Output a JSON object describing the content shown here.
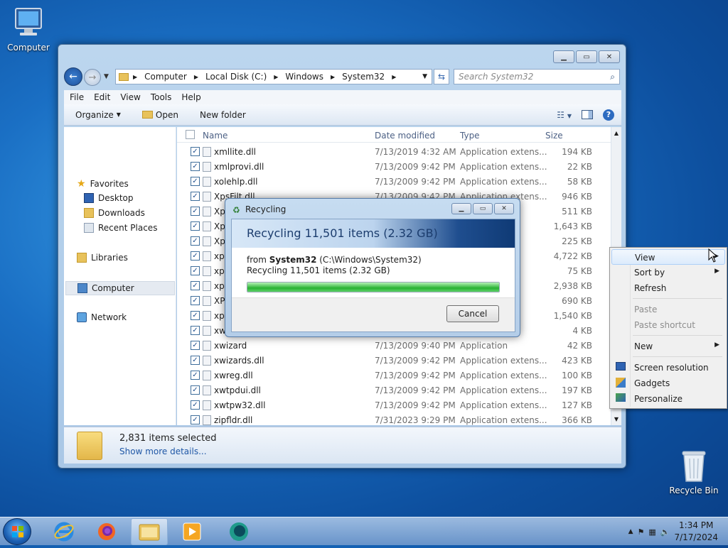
{
  "desktop": {
    "icons": [
      {
        "label": "Computer"
      },
      {
        "label": "Recycle Bin"
      }
    ]
  },
  "explorer": {
    "breadcrumb": [
      "Computer",
      "Local Disk (C:)",
      "Windows",
      "System32"
    ],
    "search_placeholder": "Search System32",
    "menu": [
      "File",
      "Edit",
      "View",
      "Tools",
      "Help"
    ],
    "toolbar": {
      "organize": "Organize",
      "open": "Open",
      "new_folder": "New folder"
    },
    "nav": {
      "favorites": "Favorites",
      "desktop": "Desktop",
      "downloads": "Downloads",
      "recent": "Recent Places",
      "libraries": "Libraries",
      "computer": "Computer",
      "network": "Network"
    },
    "columns": {
      "name": "Name",
      "date": "Date modified",
      "type": "Type",
      "size": "Size"
    },
    "files": [
      {
        "name": "xmllite.dll",
        "date": "7/13/2019 4:32 AM",
        "type": "Application extens...",
        "size": "194 KB"
      },
      {
        "name": "xmlprovi.dll",
        "date": "7/13/2009 9:42 PM",
        "type": "Application extens...",
        "size": "22 KB"
      },
      {
        "name": "xolehlp.dll",
        "date": "7/13/2009 9:42 PM",
        "type": "Application extens...",
        "size": "58 KB"
      },
      {
        "name": "XpsFilt.dll",
        "date": "7/13/2009 9:42 PM",
        "type": "Application extens...",
        "size": "946 KB"
      },
      {
        "name": "Xp",
        "date": "",
        "type": "ns...",
        "size": "511 KB"
      },
      {
        "name": "Xp",
        "date": "",
        "type": "ns...",
        "size": "1,643 KB"
      },
      {
        "name": "Xp",
        "date": "",
        "type": "ns...",
        "size": "225 KB"
      },
      {
        "name": "xps",
        "date": "",
        "type": "",
        "size": "4,722 KB"
      },
      {
        "name": "xps",
        "date": "",
        "type": "",
        "size": "75 KB"
      },
      {
        "name": "xps",
        "date": "",
        "type": "ns...",
        "size": "2,938 KB"
      },
      {
        "name": "XP",
        "date": "",
        "type": "ns...",
        "size": "690 KB"
      },
      {
        "name": "xps",
        "date": "",
        "type": "ns...",
        "size": "1,540 KB"
      },
      {
        "name": "xw",
        "date": "",
        "type": "T...",
        "size": "4 KB"
      },
      {
        "name": "xwizard",
        "date": "7/13/2009 9:40 PM",
        "type": "Application",
        "size": "42 KB"
      },
      {
        "name": "xwizards.dll",
        "date": "7/13/2009 9:42 PM",
        "type": "Application extens...",
        "size": "423 KB"
      },
      {
        "name": "xwreg.dll",
        "date": "7/13/2009 9:42 PM",
        "type": "Application extens...",
        "size": "100 KB"
      },
      {
        "name": "xwtpdui.dll",
        "date": "7/13/2009 9:42 PM",
        "type": "Application extens...",
        "size": "197 KB"
      },
      {
        "name": "xwtpw32.dll",
        "date": "7/13/2009 9:42 PM",
        "type": "Application extens...",
        "size": "127 KB"
      },
      {
        "name": "zipfldr.dll",
        "date": "7/31/2023 9:29 PM",
        "type": "Application extens...",
        "size": "366 KB"
      }
    ],
    "details": {
      "selected": "2,831 items selected",
      "more": "Show more details..."
    }
  },
  "dialog": {
    "title": "Recycling",
    "banner": "Recycling 11,501 items (2.32 GB)",
    "from_prefix": "from ",
    "from_name": "System32",
    "from_path": " (C:\\Windows\\System32)",
    "status": "Recycling 11,501 items (2.32 GB)",
    "progress": 1.0,
    "cancel": "Cancel"
  },
  "context_menu": {
    "view": "View",
    "sort_by": "Sort by",
    "refresh": "Refresh",
    "paste": "Paste",
    "paste_shortcut": "Paste shortcut",
    "new": "New",
    "screen_resolution": "Screen resolution",
    "gadgets": "Gadgets",
    "personalize": "Personalize"
  },
  "taskbar": {
    "time": "1:34 PM",
    "date": "7/17/2024"
  },
  "colors": {
    "accent": "#1f57a6",
    "progress": "#29b233"
  }
}
